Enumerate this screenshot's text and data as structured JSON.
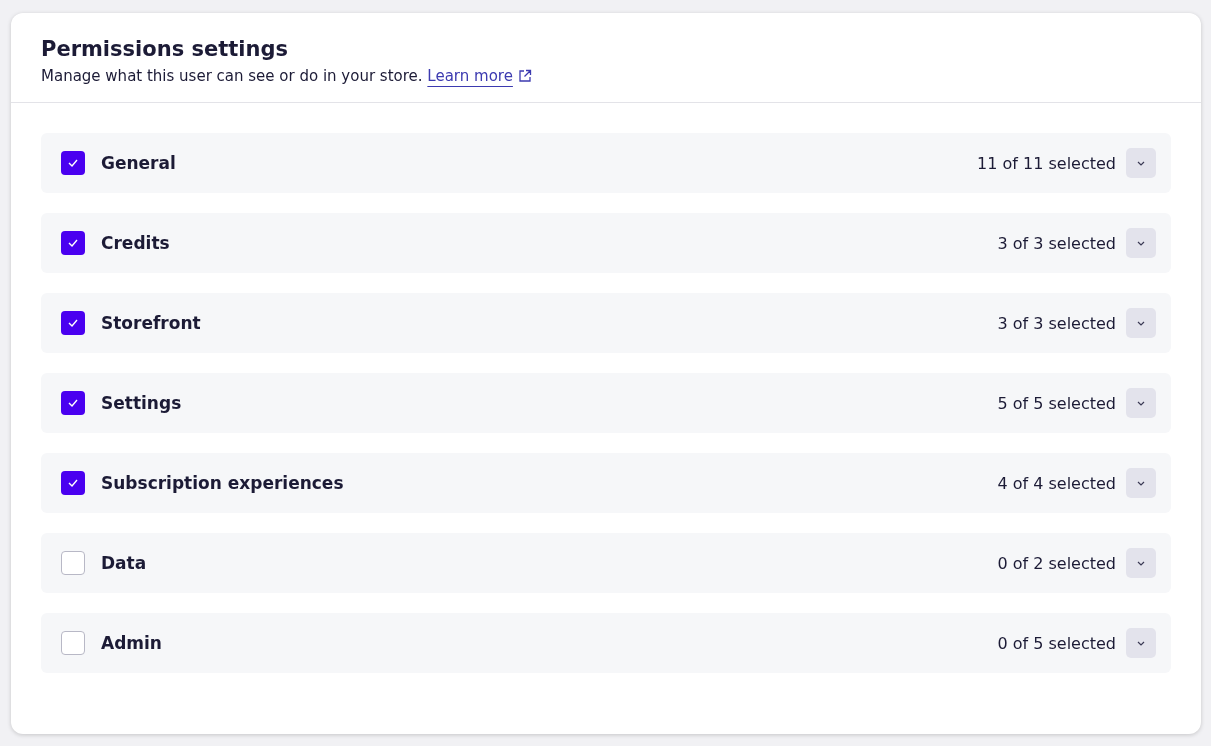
{
  "header": {
    "title": "Permissions settings",
    "description": "Manage what this user can see or do in your store.",
    "link": "Learn more"
  },
  "groups": [
    {
      "label": "General",
      "checked": true,
      "count": "11 of 11 selected"
    },
    {
      "label": "Credits",
      "checked": true,
      "count": "3 of 3 selected"
    },
    {
      "label": "Storefront",
      "checked": true,
      "count": "3 of 3 selected"
    },
    {
      "label": "Settings",
      "checked": true,
      "count": "5 of 5 selected"
    },
    {
      "label": "Subscription experiences",
      "checked": true,
      "count": "4 of 4 selected"
    },
    {
      "label": "Data",
      "checked": false,
      "count": "0 of 2 selected"
    },
    {
      "label": "Admin",
      "checked": false,
      "count": "0 of 5 selected"
    }
  ]
}
